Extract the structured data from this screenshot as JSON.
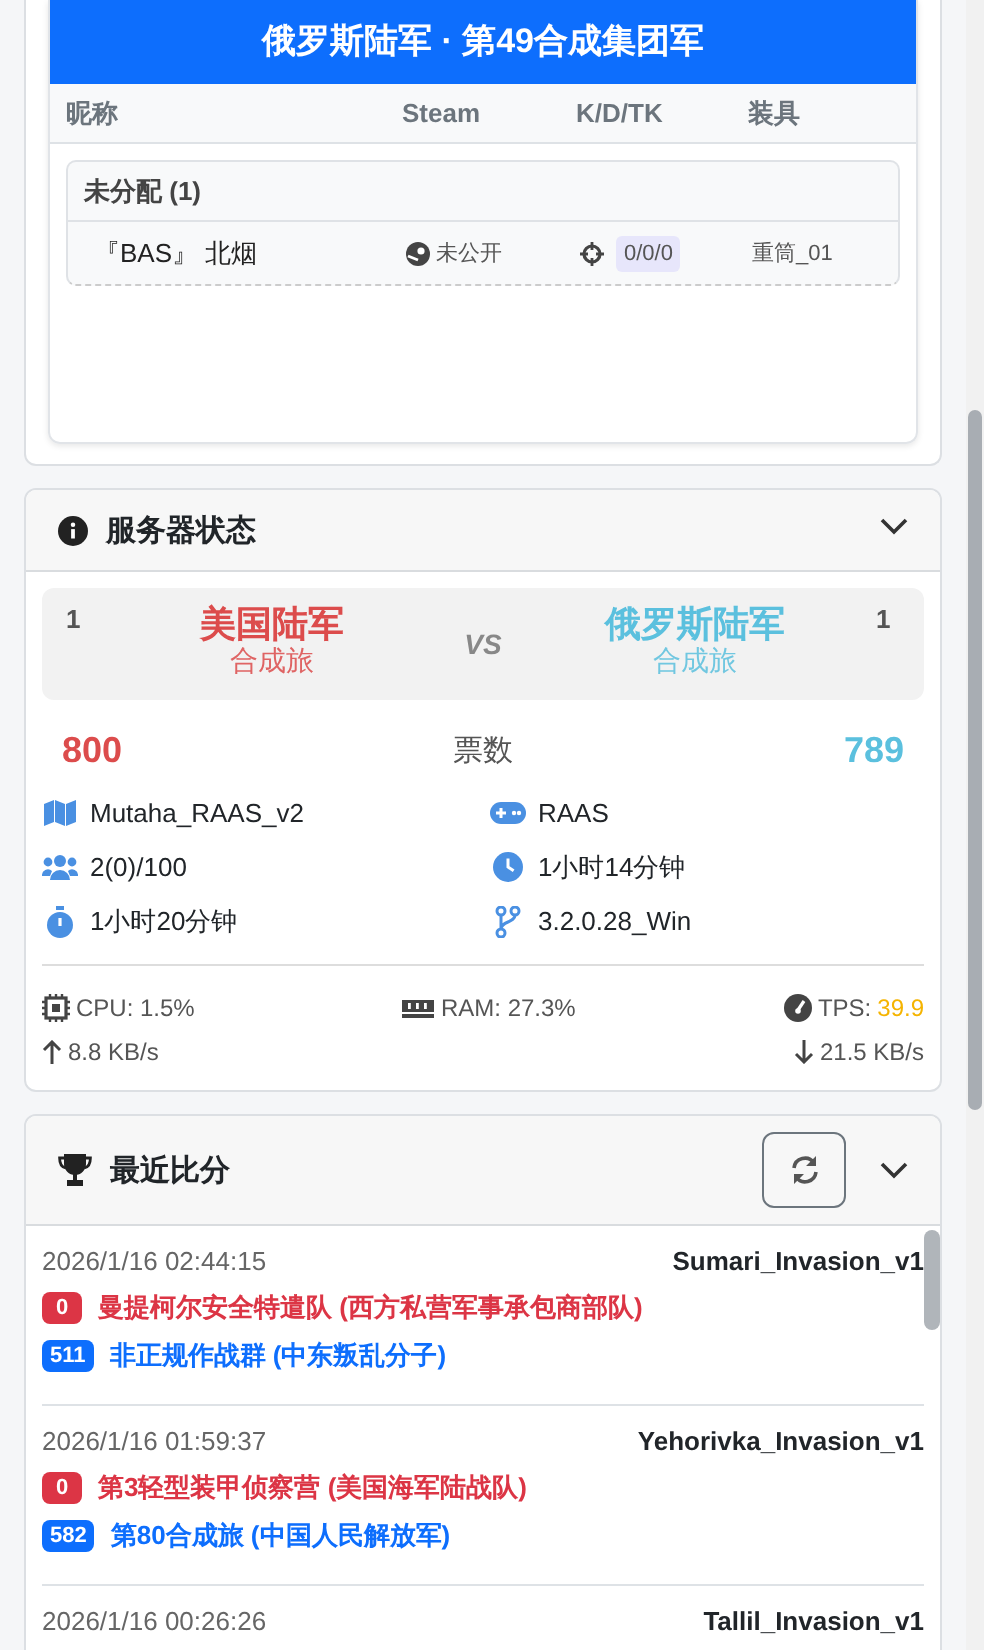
{
  "team_panel": {
    "title": "俄罗斯陆军 · 第49合成集团军",
    "columns": [
      "昵称",
      "Steam",
      "K/D/TK",
      "装具"
    ],
    "groups": [
      {
        "name": "未分配 (1)",
        "players": [
          {
            "name": "『BAS』 北烟",
            "steam": "未公开",
            "kdt": "0/0/0",
            "kit": "重筒_01"
          }
        ]
      }
    ]
  },
  "server_status": {
    "title": "服务器状态",
    "teams": [
      {
        "count": "1",
        "name": "美国陆军",
        "subtitle": "合成旅",
        "tickets": "800",
        "color": "#dc4c4c"
      },
      {
        "count": "1",
        "name": "俄罗斯陆军",
        "subtitle": "合成旅",
        "tickets": "789",
        "color": "#5bc0de"
      }
    ],
    "vs": "VS",
    "tickets_label": "票数",
    "info": [
      {
        "kind": "map",
        "text": "Mutaha_RAAS_v2"
      },
      {
        "kind": "mode",
        "text": "RAAS"
      },
      {
        "kind": "players",
        "text": "2(0)/100"
      },
      {
        "kind": "clock",
        "text": "1小时14分钟"
      },
      {
        "kind": "timer",
        "text": "1小时20分钟"
      },
      {
        "kind": "version",
        "text": "3.2.0.28_Win"
      }
    ],
    "cpu": "CPU: 1.5%",
    "ram": "RAM: 27.3%",
    "tps_label": "TPS:",
    "tps_value": "39.9",
    "upload": "8.8 KB/s",
    "download": "21.5 KB/s"
  },
  "recent_scores": {
    "title": "最近比分",
    "matches": [
      {
        "time": "2026/1/16 02:44:15",
        "map": "Sumari_Invasion_v1",
        "results": [
          {
            "score": "0",
            "team": "曼提柯尔安全特遣队 (西方私营军事承包商部队)",
            "color": "#dc3545"
          },
          {
            "score": "511",
            "team": "非正规作战群 (中东叛乱分子)",
            "color": "#0d6efd"
          }
        ]
      },
      {
        "time": "2026/1/16 01:59:37",
        "map": "Yehorivka_Invasion_v1",
        "results": [
          {
            "score": "0",
            "team": "第3轻型装甲侦察营 (美国海军陆战队)",
            "color": "#dc3545"
          },
          {
            "score": "582",
            "team": "第80合成旅 (中国人民解放军)",
            "color": "#0d6efd"
          }
        ]
      },
      {
        "time": "2026/1/16 00:26:26",
        "map": "Tallil_Invasion_v1"
      }
    ]
  }
}
